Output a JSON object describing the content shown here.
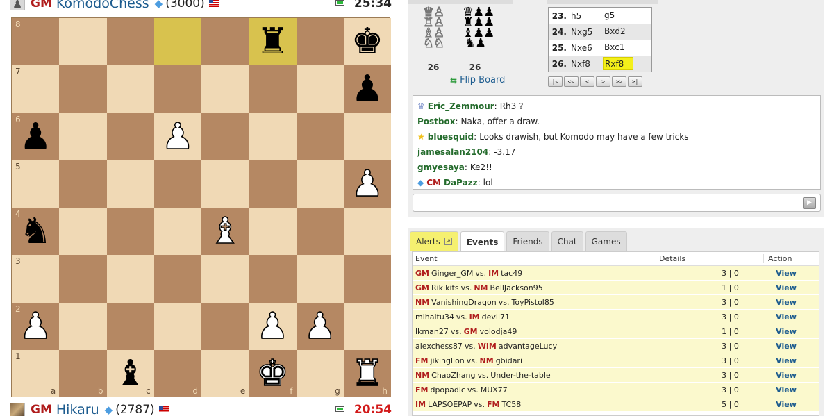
{
  "players": {
    "top": {
      "title": "GM",
      "name": "KomodoChess",
      "rating": "(3000)",
      "clock": "25:34",
      "running": false
    },
    "bottom": {
      "title": "GM",
      "name": "Hikaru",
      "rating": "(2787)",
      "clock": "20:54",
      "running": true
    }
  },
  "board": {
    "highlight": [
      "d8",
      "f8"
    ],
    "pieces": {
      "f8": "bR",
      "h8": "bK",
      "h7": "bP",
      "a6": "bP",
      "d6": "wP",
      "h5": "wP",
      "a4": "bN",
      "e4": "wB",
      "a2": "wP",
      "f2": "wP",
      "g2": "wP",
      "c1": "bB",
      "f1": "wK",
      "h1": "wR"
    }
  },
  "captured": {
    "white": {
      "rows": [
        "♕♙",
        "♖♙",
        "♗♙",
        "♘♘"
      ],
      "score": "26"
    },
    "black": {
      "rows": [
        "♛♟♟",
        "♜♟♟",
        "♝♟♟",
        "♞♟"
      ],
      "score": "26"
    }
  },
  "flip_board": "Flip Board",
  "moves": [
    {
      "n": "23.",
      "w": "h5",
      "b": "g5"
    },
    {
      "n": "24.",
      "w": "Nxg5",
      "b": "Bxd2"
    },
    {
      "n": "25.",
      "w": "Nxe6",
      "b": "Bxc1"
    },
    {
      "n": "26.",
      "w": "Nxf8",
      "b": "Rxf8",
      "current": true
    }
  ],
  "nav_buttons": [
    "|<",
    "<<",
    "<",
    ">",
    ">>",
    ">|"
  ],
  "chat": [
    {
      "icon": "crown",
      "user": "Eric_Zemmour",
      "msg": "Rh3 ?"
    },
    {
      "icon": "",
      "user": "Postbox",
      "msg": "Naka, offer a draw."
    },
    {
      "icon": "star",
      "user": "bluesquid",
      "msg": "Looks drawish, but Komodo may have a few tricks"
    },
    {
      "icon": "",
      "user": "jamesalan2104",
      "msg": "-3.17"
    },
    {
      "icon": "",
      "user": "gmyesaya",
      "msg": "Ke2!!"
    },
    {
      "icon": "diamond",
      "title": "CM",
      "user": "DaPazz",
      "msg": "lol"
    }
  ],
  "tabs": [
    "Alerts",
    "Events",
    "Friends",
    "Chat",
    "Games"
  ],
  "events_header": {
    "event": "Event",
    "details": "Details",
    "action": "Action"
  },
  "events": [
    {
      "t1": "GM",
      "p1": "Ginger_GM",
      "t2": "IM",
      "p2": "tac49",
      "details": "3 | 0"
    },
    {
      "t1": "GM",
      "p1": "Rikikits",
      "t2": "NM",
      "p2": "BellJackson95",
      "details": "1 | 0"
    },
    {
      "t1": "NM",
      "p1": "VanishingDragon",
      "t2": "",
      "p2": "ToyPistol85",
      "details": "3 | 0"
    },
    {
      "t1": "",
      "p1": "mihaitu34",
      "t2": "IM",
      "p2": "devil71",
      "details": "3 | 0"
    },
    {
      "t1": "",
      "p1": "lkman27",
      "t2": "GM",
      "p2": "volodja49",
      "details": "1 | 0"
    },
    {
      "t1": "",
      "p1": "alexchess87",
      "t2": "WIM",
      "p2": "advantageLucy",
      "details": "3 | 0"
    },
    {
      "t1": "FM",
      "p1": "jikinglion",
      "t2": "NM",
      "p2": "gbidari",
      "details": "3 | 0"
    },
    {
      "t1": "NM",
      "p1": "ChaoZhang",
      "t2": "",
      "p2": "Under-the-table",
      "details": "3 | 0"
    },
    {
      "t1": "FM",
      "p1": "dpopadic",
      "t2": "",
      "p2": "MUX77",
      "details": "3 | 0"
    },
    {
      "t1": "IM",
      "p1": "LAPSOEPAP",
      "t2": "FM",
      "p2": "TC58",
      "details": "5 | 0"
    }
  ],
  "vs": "vs.",
  "view_label": "View"
}
